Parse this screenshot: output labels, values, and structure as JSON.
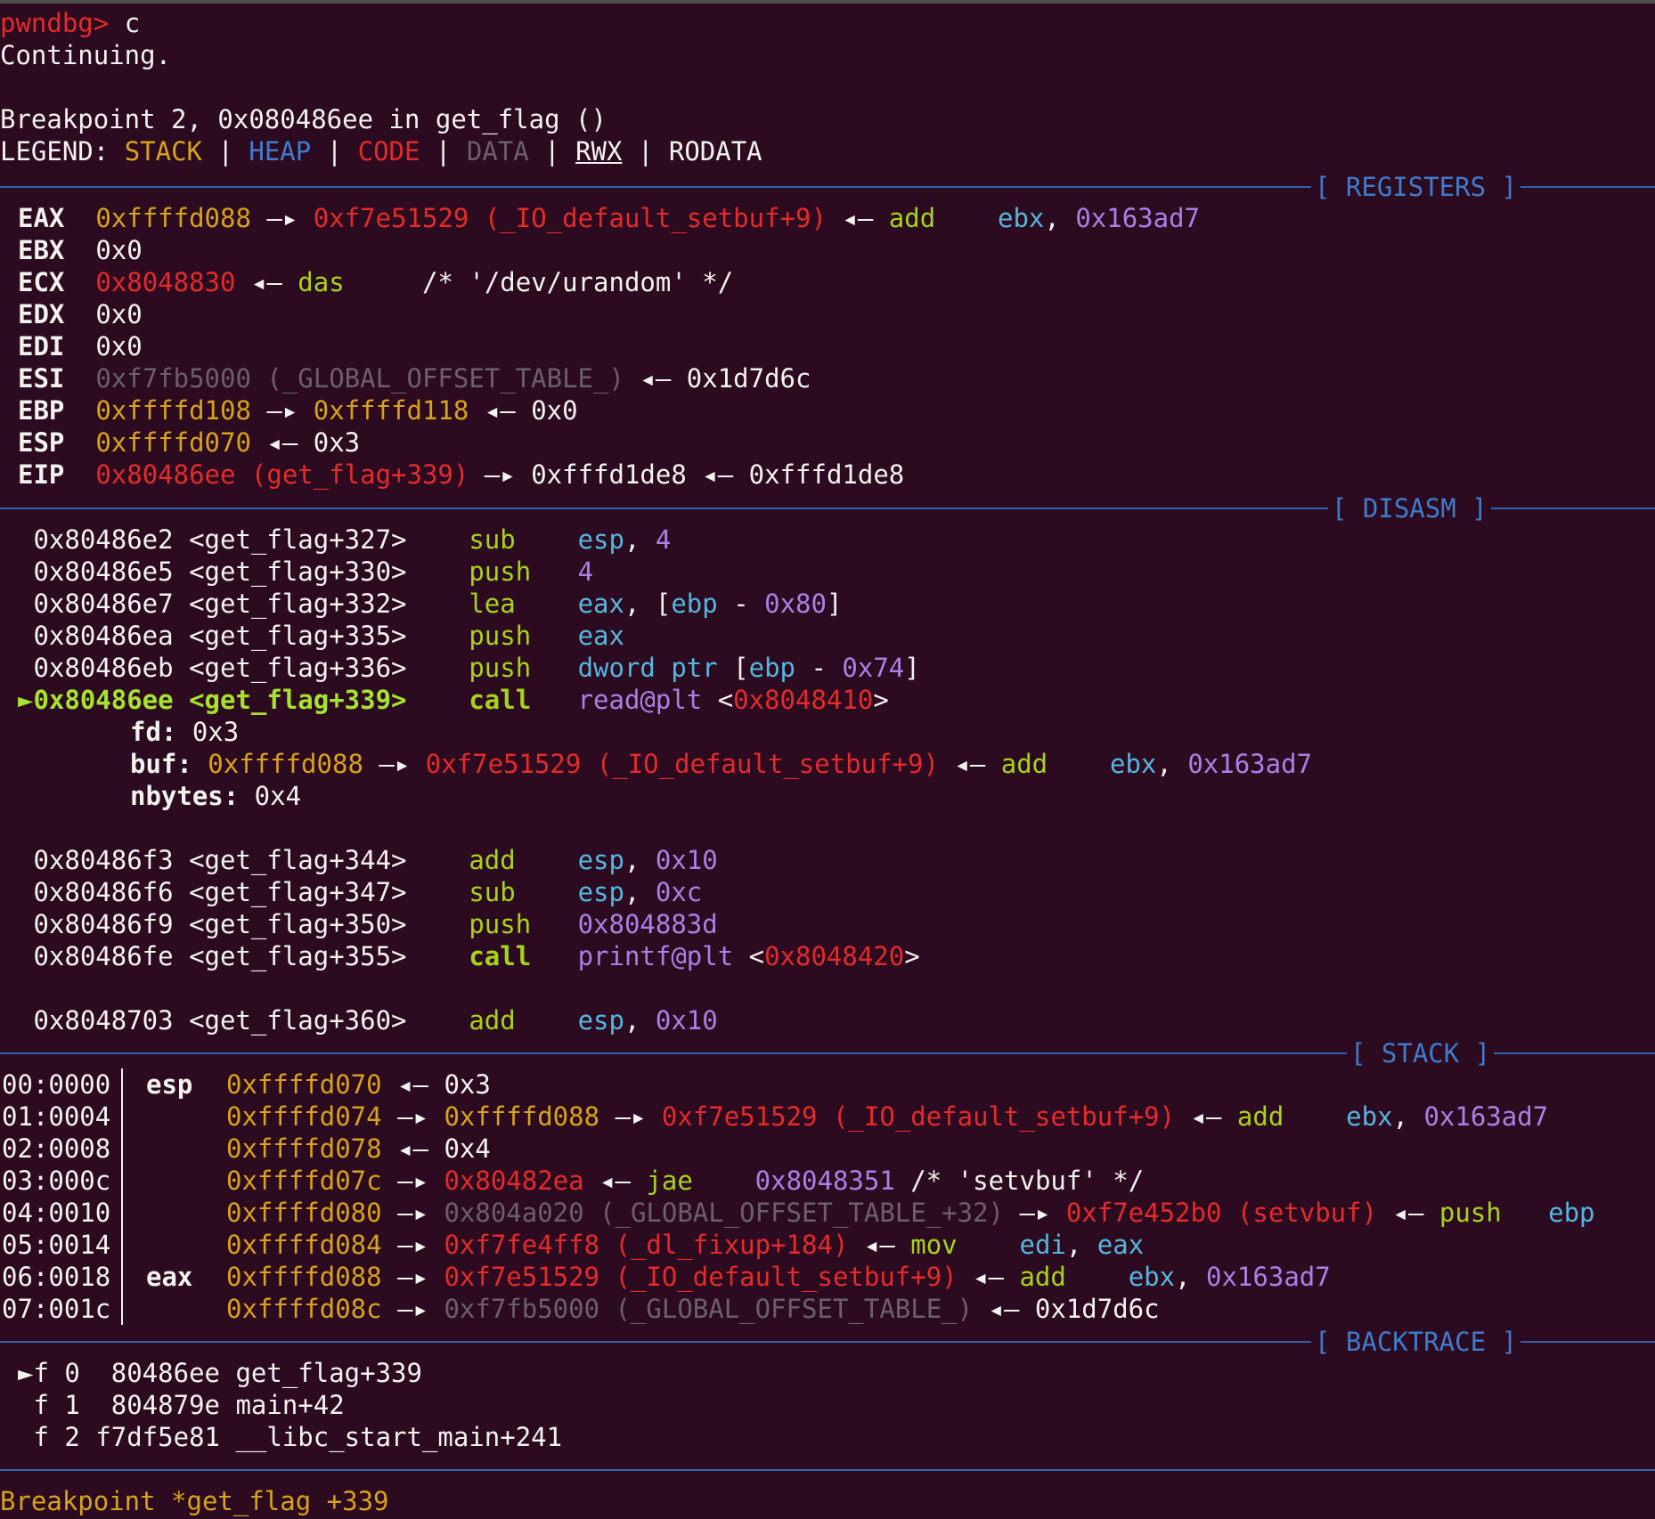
{
  "prompt": {
    "text": "pwndbg> ",
    "command": "c"
  },
  "continuing": "Continuing.",
  "breakpoint_msg": "Breakpoint 2, 0x080486ee in get_flag ()",
  "legend": {
    "label": "LEGEND: ",
    "items": [
      "STACK",
      "HEAP",
      "CODE",
      "DATA",
      "RWX",
      "RODATA"
    ],
    "sep": " | "
  },
  "sections": {
    "registers": "[ REGISTERS ]",
    "disasm": "[ DISASM ]",
    "stack": "[ STACK ]",
    "backtrace": "[ BACKTRACE ]"
  },
  "registers": [
    {
      "name": "EAX",
      "parts": [
        [
          "yel",
          "0xffffd088"
        ],
        [
          "wht",
          " —▸ "
        ],
        [
          "red",
          "0xf7e51529 (_IO_default_setbuf+9)"
        ],
        [
          "wht",
          " ◂— "
        ],
        [
          "gn",
          "add"
        ],
        [
          "wht",
          "    "
        ],
        [
          "cy",
          "ebx"
        ],
        [
          "wht",
          ", "
        ],
        [
          "pu",
          "0x163ad7"
        ]
      ]
    },
    {
      "name": "EBX",
      "parts": [
        [
          "wht",
          "0x0"
        ]
      ]
    },
    {
      "name": "ECX",
      "parts": [
        [
          "red",
          "0x8048830"
        ],
        [
          "wht",
          " ◂— "
        ],
        [
          "gn",
          "das"
        ],
        [
          "wht",
          "     /* '/dev/urandom' */"
        ]
      ]
    },
    {
      "name": "EDX",
      "parts": [
        [
          "wht",
          "0x0"
        ]
      ]
    },
    {
      "name": "EDI",
      "parts": [
        [
          "wht",
          "0x0"
        ]
      ]
    },
    {
      "name": "ESI",
      "parts": [
        [
          "grey",
          "0xf7fb5000 (_GLOBAL_OFFSET_TABLE_)"
        ],
        [
          "wht",
          " ◂— "
        ],
        [
          "wht",
          "0x1d7d6c"
        ]
      ]
    },
    {
      "name": "EBP",
      "parts": [
        [
          "yel",
          "0xffffd108"
        ],
        [
          "wht",
          " —▸ "
        ],
        [
          "yel",
          "0xffffd118"
        ],
        [
          "wht",
          " ◂— "
        ],
        [
          "wht",
          "0x0"
        ]
      ]
    },
    {
      "name": "ESP",
      "parts": [
        [
          "yel",
          "0xffffd070"
        ],
        [
          "wht",
          " ◂— "
        ],
        [
          "wht",
          "0x3"
        ]
      ]
    },
    {
      "name": "EIP",
      "parts": [
        [
          "red",
          "0x80486ee (get_flag+339)"
        ],
        [
          "wht",
          " —▸ "
        ],
        [
          "wht",
          "0xfffd1de8"
        ],
        [
          "wht",
          " ◂— "
        ],
        [
          "wht",
          "0xfffd1de8"
        ]
      ]
    }
  ],
  "disasm": [
    {
      "addr": "0x80486e2 <get_flag+327>",
      "op": "sub",
      "args": [
        [
          "cy",
          "esp"
        ],
        [
          "wht",
          ", "
        ],
        [
          "pu",
          "4"
        ]
      ]
    },
    {
      "addr": "0x80486e5 <get_flag+330>",
      "op": "push",
      "args": [
        [
          "pu",
          "4"
        ]
      ]
    },
    {
      "addr": "0x80486e7 <get_flag+332>",
      "op": "lea",
      "args": [
        [
          "cy",
          "eax"
        ],
        [
          "wht",
          ", ["
        ],
        [
          "cy",
          "ebp"
        ],
        [
          "wht",
          " - "
        ],
        [
          "pu",
          "0x80"
        ],
        [
          "wht",
          "]"
        ]
      ]
    },
    {
      "addr": "0x80486ea <get_flag+335>",
      "op": "push",
      "args": [
        [
          "cy",
          "eax"
        ]
      ]
    },
    {
      "addr": "0x80486eb <get_flag+336>",
      "op": "push",
      "args": [
        [
          "cy",
          "dword ptr"
        ],
        [
          "wht",
          " ["
        ],
        [
          "cy",
          "ebp"
        ],
        [
          "wht",
          " - "
        ],
        [
          "pu",
          "0x74"
        ],
        [
          "wht",
          "]"
        ]
      ]
    },
    {
      "addr": "0x80486ee <get_flag+339>",
      "op": "call",
      "current": true,
      "args": [
        [
          "pu",
          "read@plt"
        ],
        [
          "wht",
          " <"
        ],
        [
          "red",
          "0x8048410"
        ],
        [
          "wht",
          ">"
        ]
      ]
    },
    {
      "addr": "0x80486f3 <get_flag+344>",
      "op": "add",
      "args": [
        [
          "cy",
          "esp"
        ],
        [
          "wht",
          ", "
        ],
        [
          "pu",
          "0x10"
        ]
      ]
    },
    {
      "addr": "0x80486f6 <get_flag+347>",
      "op": "sub",
      "args": [
        [
          "cy",
          "esp"
        ],
        [
          "wht",
          ", "
        ],
        [
          "pu",
          "0xc"
        ]
      ]
    },
    {
      "addr": "0x80486f9 <get_flag+350>",
      "op": "push",
      "args": [
        [
          "pu",
          "0x804883d"
        ]
      ]
    },
    {
      "addr": "0x80486fe <get_flag+355>",
      "op": "call",
      "args": [
        [
          "pu",
          "printf@plt"
        ],
        [
          "wht",
          " <"
        ],
        [
          "red",
          "0x8048420"
        ],
        [
          "wht",
          ">"
        ]
      ]
    },
    {
      "addr": "0x8048703 <get_flag+360>",
      "op": "add",
      "args": [
        [
          "cy",
          "esp"
        ],
        [
          "wht",
          ", "
        ],
        [
          "pu",
          "0x10"
        ]
      ]
    }
  ],
  "call_args": [
    {
      "name": "fd:",
      "parts": [
        [
          "wht",
          " 0x3"
        ]
      ]
    },
    {
      "name": "buf:",
      "parts": [
        [
          "yel",
          " 0xffffd088"
        ],
        [
          "wht",
          " —▸ "
        ],
        [
          "red",
          "0xf7e51529 (_IO_default_setbuf+9)"
        ],
        [
          "wht",
          " ◂— "
        ],
        [
          "gn",
          "add"
        ],
        [
          "wht",
          "    "
        ],
        [
          "cy",
          "ebx"
        ],
        [
          "wht",
          ", "
        ],
        [
          "pu",
          "0x163ad7"
        ]
      ]
    },
    {
      "name": "nbytes:",
      "parts": [
        [
          "wht",
          " 0x4"
        ]
      ]
    }
  ],
  "stack": [
    {
      "off": "00:0000",
      "reg": "esp",
      "parts": [
        [
          "yel",
          "0xffffd070"
        ],
        [
          "wht",
          " ◂— "
        ],
        [
          "wht",
          "0x3"
        ]
      ]
    },
    {
      "off": "01:0004",
      "reg": "",
      "parts": [
        [
          "yel",
          "0xffffd074"
        ],
        [
          "wht",
          " —▸ "
        ],
        [
          "yel",
          "0xffffd088"
        ],
        [
          "wht",
          " —▸ "
        ],
        [
          "red",
          "0xf7e51529 (_IO_default_setbuf+9)"
        ],
        [
          "wht",
          " ◂— "
        ],
        [
          "gn",
          "add"
        ],
        [
          "wht",
          "    "
        ],
        [
          "cy",
          "ebx"
        ],
        [
          "wht",
          ", "
        ],
        [
          "pu",
          "0x163ad7"
        ]
      ]
    },
    {
      "off": "02:0008",
      "reg": "",
      "parts": [
        [
          "yel",
          "0xffffd078"
        ],
        [
          "wht",
          " ◂— "
        ],
        [
          "wht",
          "0x4"
        ]
      ]
    },
    {
      "off": "03:000c",
      "reg": "",
      "parts": [
        [
          "yel",
          "0xffffd07c"
        ],
        [
          "wht",
          " —▸ "
        ],
        [
          "red",
          "0x80482ea"
        ],
        [
          "wht",
          " ◂— "
        ],
        [
          "gn",
          "jae"
        ],
        [
          "wht",
          "    "
        ],
        [
          "pu",
          "0x8048351"
        ],
        [
          "wht",
          " /* 'setvbuf' */"
        ]
      ]
    },
    {
      "off": "04:0010",
      "reg": "",
      "parts": [
        [
          "yel",
          "0xffffd080"
        ],
        [
          "wht",
          " —▸ "
        ],
        [
          "grey",
          "0x804a020 (_GLOBAL_OFFSET_TABLE_+32)"
        ],
        [
          "wht",
          " —▸ "
        ],
        [
          "red",
          "0xf7e452b0 (setvbuf)"
        ],
        [
          "wht",
          " ◂— "
        ],
        [
          "gn",
          "push"
        ],
        [
          "wht",
          "   "
        ],
        [
          "cy",
          "ebp"
        ]
      ]
    },
    {
      "off": "05:0014",
      "reg": "",
      "parts": [
        [
          "yel",
          "0xffffd084"
        ],
        [
          "wht",
          " —▸ "
        ],
        [
          "red",
          "0xf7fe4ff8 (_dl_fixup+184)"
        ],
        [
          "wht",
          " ◂— "
        ],
        [
          "gn",
          "mov"
        ],
        [
          "wht",
          "    "
        ],
        [
          "cy",
          "edi"
        ],
        [
          "wht",
          ", "
        ],
        [
          "cy",
          "eax"
        ]
      ]
    },
    {
      "off": "06:0018",
      "reg": "eax",
      "parts": [
        [
          "yel",
          "0xffffd088"
        ],
        [
          "wht",
          " —▸ "
        ],
        [
          "red",
          "0xf7e51529 (_IO_default_setbuf+9)"
        ],
        [
          "wht",
          " ◂— "
        ],
        [
          "gn",
          "add"
        ],
        [
          "wht",
          "    "
        ],
        [
          "cy",
          "ebx"
        ],
        [
          "wht",
          ", "
        ],
        [
          "pu",
          "0x163ad7"
        ]
      ]
    },
    {
      "off": "07:001c",
      "reg": "",
      "parts": [
        [
          "yel",
          "0xffffd08c"
        ],
        [
          "wht",
          " —▸ "
        ],
        [
          "grey",
          "0xf7fb5000 (_GLOBAL_OFFSET_TABLE_)"
        ],
        [
          "wht",
          " ◂— "
        ],
        [
          "wht",
          "0x1d7d6c"
        ]
      ]
    }
  ],
  "backtrace": [
    {
      "marker": "►",
      "text": "f 0  80486ee get_flag+339"
    },
    {
      "marker": " ",
      "text": "f 1  804879e main+42"
    },
    {
      "marker": " ",
      "text": "f 2 f7df5e81 __libc_start_main+241"
    }
  ],
  "footer": "Breakpoint *get_flag +339"
}
